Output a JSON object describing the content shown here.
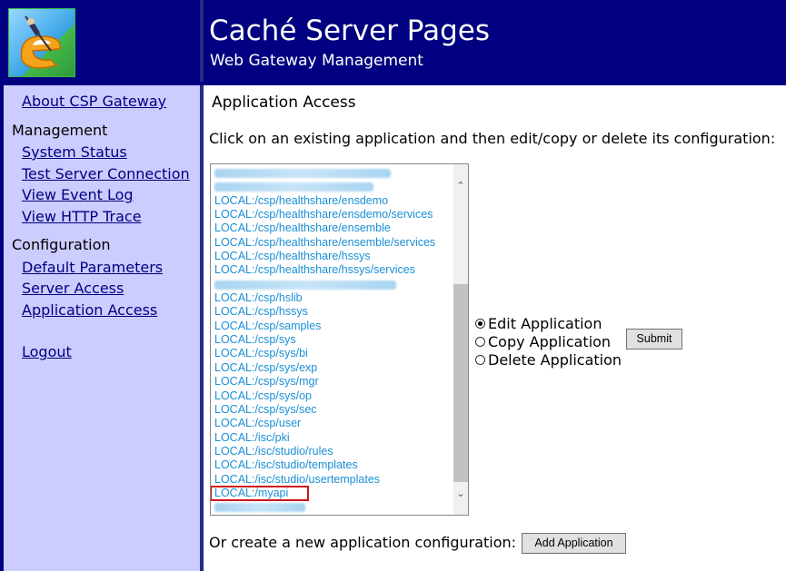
{
  "header": {
    "title": "Caché Server Pages",
    "subtitle": "Web Gateway Management",
    "background_color": "#000080",
    "logo_icon": "csp-logo-icon"
  },
  "nav": {
    "background_color": "#ccccff",
    "top_link": "About CSP Gateway",
    "management_heading": "Management",
    "management_links": [
      "System Status",
      "Test Server Connection",
      "View Event Log",
      "View HTTP Trace"
    ],
    "configuration_heading": "Configuration",
    "configuration_links": [
      "Default Parameters",
      "Server Access",
      "Application Access"
    ],
    "logout": "Logout"
  },
  "main": {
    "title": "Application Access",
    "intro": "Click on an existing application and then edit/copy or delete its configuration:",
    "applications": [
      "",
      "",
      "LOCAL:/csp/healthshare/ensdemo",
      "LOCAL:/csp/healthshare/ensdemo/services",
      "LOCAL:/csp/healthshare/ensemble",
      "LOCAL:/csp/healthshare/ensemble/services",
      "LOCAL:/csp/healthshare/hssys",
      "LOCAL:/csp/healthshare/hssys/services",
      "",
      "LOCAL:/csp/hslib",
      "LOCAL:/csp/hssys",
      "LOCAL:/csp/samples",
      "LOCAL:/csp/sys",
      "LOCAL:/csp/sys/bi",
      "LOCAL:/csp/sys/exp",
      "LOCAL:/csp/sys/mgr",
      "LOCAL:/csp/sys/op",
      "LOCAL:/csp/sys/sec",
      "LOCAL:/csp/user",
      "LOCAL:/isc/pki",
      "LOCAL:/isc/studio/rules",
      "LOCAL:/isc/studio/templates",
      "LOCAL:/isc/studio/usertemplates",
      "LOCAL:/myapi",
      ""
    ],
    "selected_application": "LOCAL:/myapi",
    "options": [
      "Edit Application",
      "Copy Application",
      "Delete Application"
    ],
    "selected_option": "Edit Application",
    "submit_label": "Submit",
    "create_text": "Or create a new application configuration:",
    "add_label": "Add Application"
  }
}
